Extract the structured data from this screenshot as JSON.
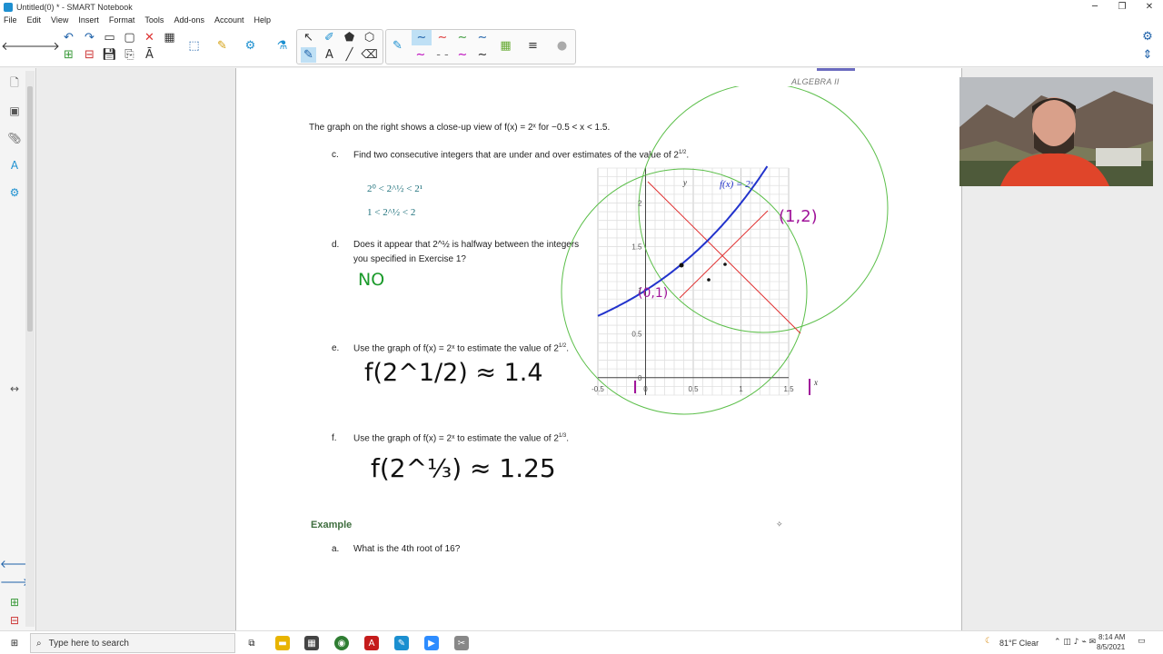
{
  "window": {
    "title": "Untitled(0) * - SMART Notebook",
    "controls": [
      "─",
      "❐",
      "✕"
    ]
  },
  "menu": [
    "File",
    "Edit",
    "View",
    "Insert",
    "Format",
    "Tools",
    "Add-ons",
    "Account",
    "Help"
  ],
  "page": {
    "header": "ALGEBRA II",
    "intro": "The graph on the right shows a close-up view of f(x) = 2ˣ for −0.5 < x < 1.5.",
    "c": {
      "letter": "c.",
      "question": "Find two consecutive integers that are under and over estimates of the value of 2",
      "exp": "1/2",
      "tail": ".",
      "line1": "2⁰ < 2^½ < 2¹",
      "line2": "1 < 2^½ < 2"
    },
    "d": {
      "letter": "d.",
      "question_line1": "Does it appear that 2^½ is halfway between the integers",
      "question_line2": "you specified in Exercise 1?",
      "answer": "NO"
    },
    "e": {
      "letter": "e.",
      "question": "Use the graph of f(x) = 2ˣ to estimate the value of 2",
      "exp": "1/2",
      "tail": ".",
      "answer": "f(2^1/2) ≈ 1.4"
    },
    "f": {
      "letter": "f.",
      "question": "Use the graph of f(x) = 2ˣ to estimate the value of 2",
      "exp": "1/3",
      "tail": ".",
      "answer": "f(2^⅓) ≈ 1.25"
    },
    "example": {
      "label": "Example",
      "a_letter": "a.",
      "a_question": "What is the 4th root of 16?"
    }
  },
  "graph": {
    "func_label": "f(x) = 2ˣ",
    "point1": "(1,2)",
    "point2": "(0,1)",
    "y_axis": "y",
    "x_axis": "x",
    "y_ticks": [
      "2",
      "1.5",
      "1",
      "0.5",
      "0"
    ],
    "x_ticks": [
      "-0.5",
      "0",
      "0.5",
      "1",
      "1.5"
    ],
    "xlim": [
      -0.5,
      1.5
    ],
    "ylim": [
      -0.2,
      2.4
    ],
    "curve_color": "#2233cc",
    "secant_color": "#e03030",
    "circle_color": "#5cbf4a"
  },
  "taskbar": {
    "search_placeholder": "Type here to search",
    "weather": "81°F  Clear",
    "time": "8:14 AM",
    "date": "8/5/2021"
  }
}
